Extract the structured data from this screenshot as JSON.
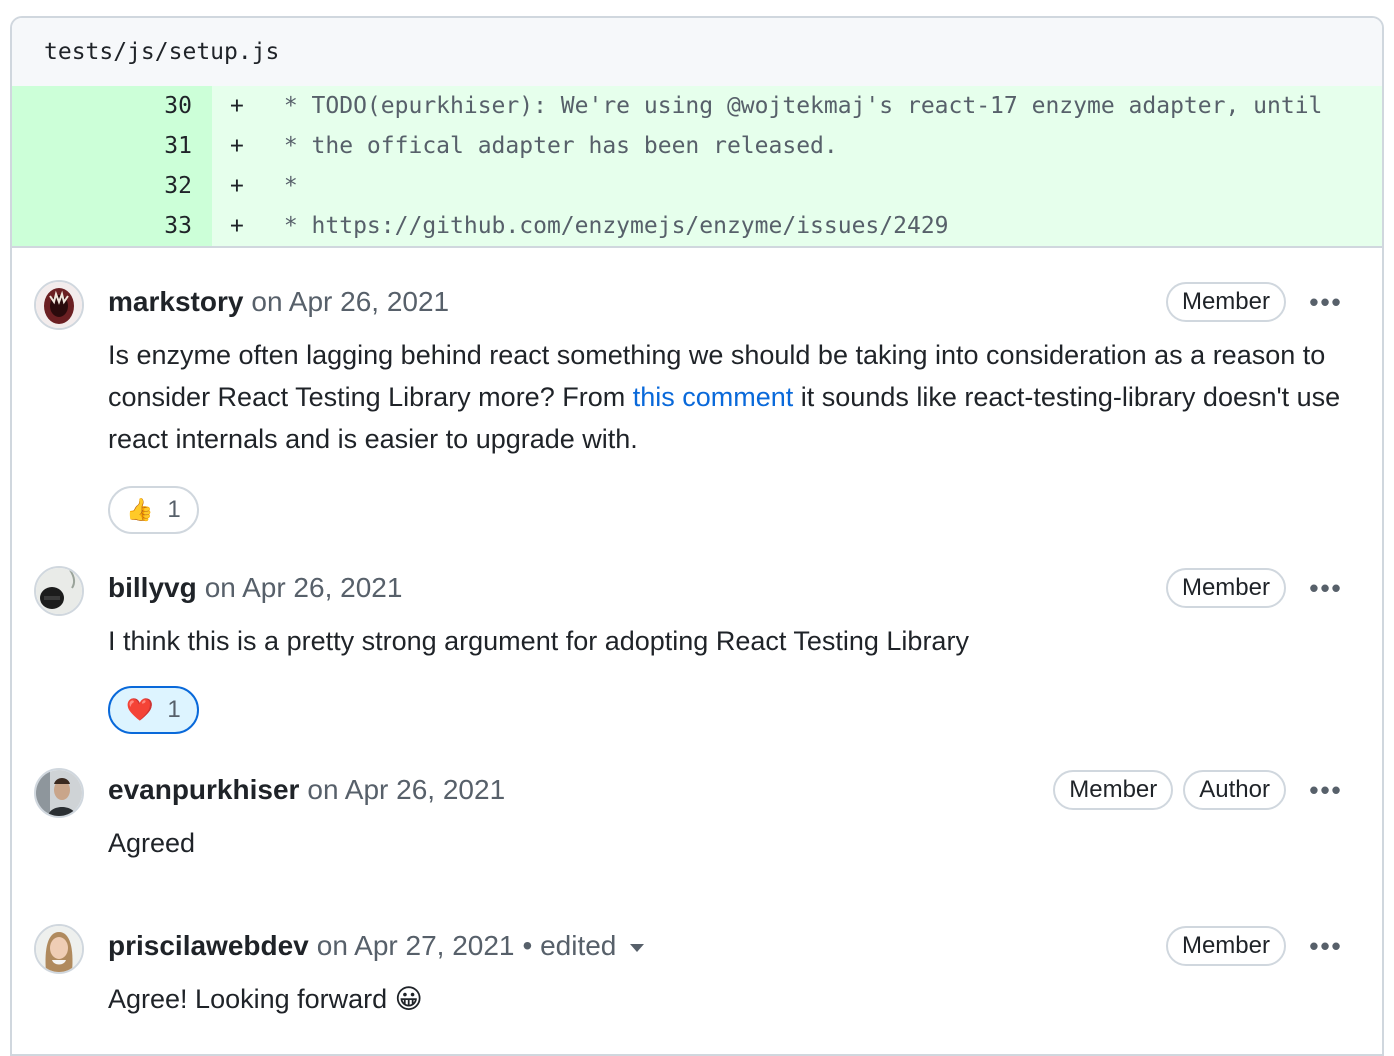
{
  "file": {
    "path": "tests/js/setup.js"
  },
  "diff_lines": [
    {
      "num": "30",
      "sign": "+",
      "text": " * TODO(epurkhiser): We're using @wojtekmaj's react-17 enzyme adapter, until"
    },
    {
      "num": "31",
      "sign": "+",
      "text": " * the offical adapter has been released."
    },
    {
      "num": "32",
      "sign": "+",
      "text": " *"
    },
    {
      "num": "33",
      "sign": "+",
      "text": " * https://github.com/enzymejs/enzyme/issues/2429"
    }
  ],
  "comments": [
    {
      "author": "markstory",
      "date": "on Apr 26, 2021",
      "badges": [
        "Member"
      ],
      "body_pre": "Is enzyme often lagging behind react something we should be taking into consideration as a reason to consider React Testing Library more? From ",
      "body_link": "this comment",
      "body_post": " it sounds like react-testing-library doesn't use react internals and is easier to upgrade with.",
      "reaction": {
        "emoji": "👍",
        "count": "1"
      }
    },
    {
      "author": "billyvg",
      "date": "on Apr 26, 2021",
      "badges": [
        "Member"
      ],
      "body": "I think this is a pretty strong argument for adopting React Testing Library",
      "reaction": {
        "emoji": "❤️",
        "count": "1"
      }
    },
    {
      "author": "evanpurkhiser",
      "date": "on Apr 26, 2021",
      "badges": [
        "Member",
        "Author"
      ],
      "body": "Agreed"
    },
    {
      "author": "priscilawebdev",
      "date": "on Apr 27, 2021",
      "edited": "• edited",
      "badges": [
        "Member"
      ],
      "body": "Agree! Looking forward 😀"
    }
  ],
  "icons": {
    "kebab": "kebab-horizontal-icon",
    "caret": "caret-down-icon"
  },
  "colors": {
    "added_num_bg": "#ccffd8",
    "added_code_bg": "#e6ffec",
    "link": "#0969da",
    "reaction_active_bg": "#ddf4ff"
  }
}
